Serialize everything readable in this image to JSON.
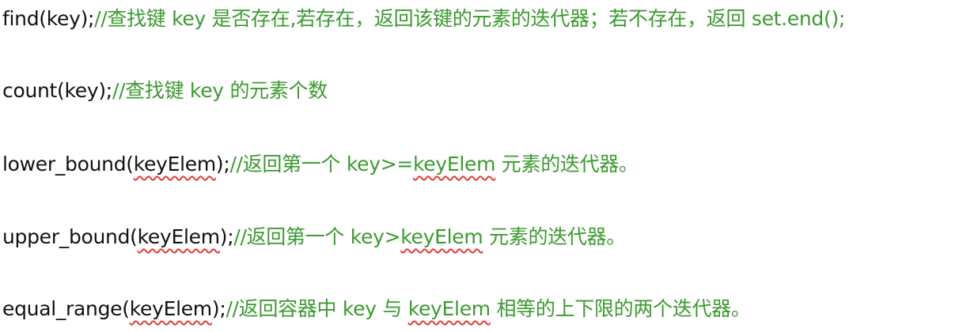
{
  "lines": [
    {
      "code": "find(key);",
      "comment": "//查找键 key 是否存在,若存在，返回该键的元素的迭代器；若不存在，返回 set.end();"
    },
    {
      "code": "count(key);",
      "comment": "//查找键 key 的元素个数"
    },
    {
      "code_prefix": "lower_bound(",
      "code_flagged": "keyElem",
      "code_suffix": ");",
      "comment_prefix": "//返回第一个 key>=",
      "comment_flagged": "keyElem",
      "comment_suffix": " 元素的迭代器。"
    },
    {
      "code_prefix": "upper_bound(",
      "code_flagged": "keyElem",
      "code_suffix": ");",
      "comment_prefix": "//返回第一个 key>",
      "comment_flagged": "keyElem",
      "comment_suffix": " 元素的迭代器。"
    },
    {
      "code_prefix": "equal_range(",
      "code_flagged": "keyElem",
      "code_suffix": ");",
      "comment_prefix": "//返回容器中 key 与 ",
      "comment_flagged": "keyElem",
      "comment_suffix": " 相等的上下限的两个迭代器。"
    }
  ],
  "colors": {
    "code": "#111111",
    "comment": "#3c9a31",
    "spellcheck_underline": "#e23b3b",
    "background": "#ffffff"
  }
}
